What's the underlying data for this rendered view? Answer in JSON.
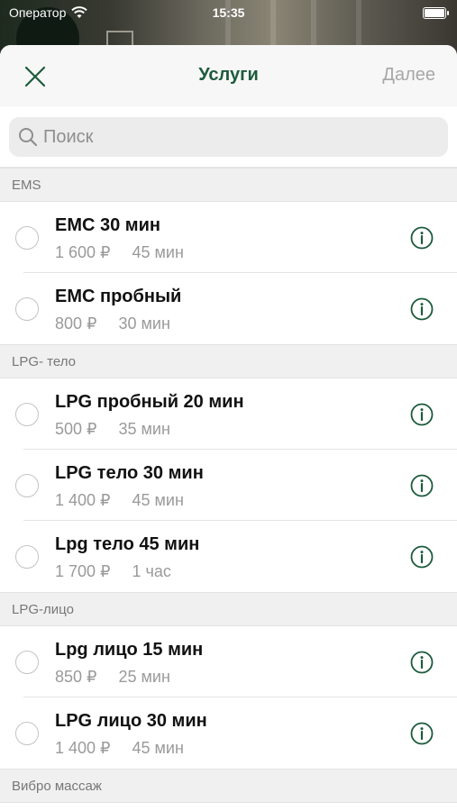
{
  "status_bar": {
    "carrier": "Оператор",
    "time": "15:35"
  },
  "nav": {
    "title": "Услуги",
    "next_label": "Далее"
  },
  "search": {
    "placeholder": "Поиск"
  },
  "colors": {
    "accent": "#1c5b3c",
    "muted": "#a7a7a7"
  },
  "sections": [
    {
      "title": "EMS",
      "items": [
        {
          "name": "ЕМС 30 мин",
          "price": "1 600 ₽",
          "duration": "45 мин"
        },
        {
          "name": "ЕМС пробный",
          "price": "800 ₽",
          "duration": "30 мин"
        }
      ]
    },
    {
      "title": "LPG- тело",
      "items": [
        {
          "name": "LPG пробный 20 мин",
          "price": "500 ₽",
          "duration": "35 мин"
        },
        {
          "name": "LPG тело 30 мин",
          "price": "1 400 ₽",
          "duration": "45 мин"
        },
        {
          "name": "Lpg тело 45 мин",
          "price": "1 700 ₽",
          "duration": "1 час"
        }
      ]
    },
    {
      "title": "LPG-лицо",
      "items": [
        {
          "name": "Lpg лицо 15 мин",
          "price": "850 ₽",
          "duration": "25 мин"
        },
        {
          "name": "LPG лицо 30 мин",
          "price": "1 400 ₽",
          "duration": "45 мин"
        }
      ]
    },
    {
      "title": "Вибро массаж",
      "items": []
    }
  ]
}
